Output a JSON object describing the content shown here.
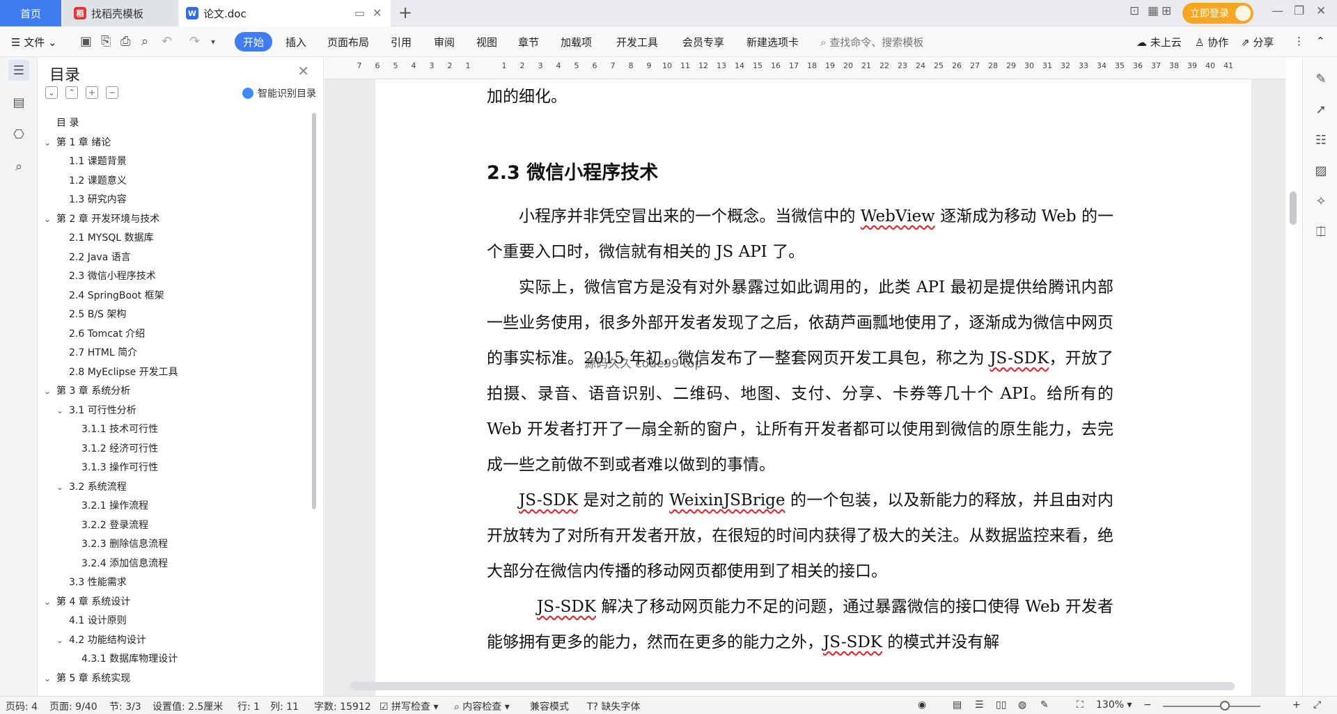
{
  "tabs": {
    "home": "首页",
    "templates": "找稻壳模板",
    "document": "论文.doc"
  },
  "header": {
    "login": "立即登录"
  },
  "ribbon": {
    "file": "文件",
    "menus": [
      "开始",
      "插入",
      "页面布局",
      "引用",
      "审阅",
      "视图",
      "章节",
      "加载项",
      "开发工具",
      "会员专享",
      "新建选项卡"
    ],
    "search_placeholder": "查找命令、搜索模板",
    "cloud": "未上云",
    "collab": "协作",
    "share": "分享"
  },
  "toc": {
    "title": "目录",
    "smart": "智能识别目录",
    "items": [
      {
        "label": "目  录",
        "level": 0,
        "expand": false
      },
      {
        "label": "第 1 章  绪论",
        "level": 0,
        "expand": true
      },
      {
        "label": "1.1  课题背景",
        "level": 1,
        "expand": false
      },
      {
        "label": "1.2  课题意义",
        "level": 1,
        "expand": false
      },
      {
        "label": "1.3  研究内容",
        "level": 1,
        "expand": false
      },
      {
        "label": "第 2 章  开发环境与技术",
        "level": 0,
        "expand": true
      },
      {
        "label": "2.1 MYSQL 数据库",
        "level": 1,
        "expand": false
      },
      {
        "label": "2.2 Java 语言",
        "level": 1,
        "expand": false
      },
      {
        "label": "2.3  微信小程序技术",
        "level": 1,
        "expand": false
      },
      {
        "label": "2.4 SpringBoot 框架",
        "level": 1,
        "expand": false
      },
      {
        "label": "2.5 B/S 架构",
        "level": 1,
        "expand": false
      },
      {
        "label": "2.6 Tomcat  介绍",
        "level": 1,
        "expand": false
      },
      {
        "label": "2.7 HTML 简介",
        "level": 1,
        "expand": false
      },
      {
        "label": "2.8 MyEclipse 开发工具",
        "level": 1,
        "expand": false
      },
      {
        "label": "第 3 章  系统分析",
        "level": 0,
        "expand": true
      },
      {
        "label": "3.1  可行性分析",
        "level": 1,
        "expand": true
      },
      {
        "label": "3.1.1  技术可行性",
        "level": 2,
        "expand": false
      },
      {
        "label": "3.1.2  经济可行性",
        "level": 2,
        "expand": false
      },
      {
        "label": "3.1.3  操作可行性",
        "level": 2,
        "expand": false
      },
      {
        "label": "3.2  系统流程",
        "level": 1,
        "expand": true
      },
      {
        "label": "3.2.1  操作流程",
        "level": 2,
        "expand": false
      },
      {
        "label": "3.2.2  登录流程",
        "level": 2,
        "expand": false
      },
      {
        "label": "3.2.3  删除信息流程",
        "level": 2,
        "expand": false
      },
      {
        "label": "3.2.4  添加信息流程",
        "level": 2,
        "expand": false
      },
      {
        "label": "3.3  性能需求",
        "level": 1,
        "expand": false
      },
      {
        "label": "第 4 章  系统设计",
        "level": 0,
        "expand": true
      },
      {
        "label": "4.1  设计原则",
        "level": 1,
        "expand": false
      },
      {
        "label": "4.2  功能结构设计",
        "level": 1,
        "expand": true
      },
      {
        "label": "4.3.1  数据库物理设计",
        "level": 2,
        "expand": false
      },
      {
        "label": "第 5 章  系统实现",
        "level": 0,
        "expand": true
      }
    ]
  },
  "ruler": [
    "7",
    "6",
    "5",
    "4",
    "3",
    "2",
    "1",
    "",
    "1",
    "2",
    "3",
    "4",
    "5",
    "6",
    "7",
    "8",
    "9",
    "10",
    "11",
    "12",
    "13",
    "14",
    "15",
    "16",
    "17",
    "18",
    "19",
    "20",
    "21",
    "22",
    "23",
    "24",
    "25",
    "26",
    "27",
    "28",
    "29",
    "30",
    "31",
    "32",
    "33",
    "34",
    "35",
    "36",
    "37",
    "38",
    "39",
    "40",
    "41"
  ],
  "document": {
    "line_prev": "加的细化。",
    "heading": "2.3  微信小程序技术",
    "p1_a": "小程序并非凭空冒出来的一个概念。当微信中的 ",
    "p1_b": "WebView",
    "p1_c": " 逐渐成为移动 Web 的一个重要入口时，微信就有相关的 JS API 了。",
    "p2_a": "实际上，微信官方是没有对外暴露过如此调用的，此类 API 最初是提供给腾讯内部一些业务使用，很多外部开发者发现了之后，依葫芦画瓢地使用了，逐渐成为微信中网页的事实标准。2015 年初，微信发布了一整套网页开发工具包，称之为 ",
    "p2_b": "JS-SDK",
    "p2_c": "，开放了拍摄、录音、语音识别、二维码、地图、支付、分享、卡券等几十个 API。给所有的 Web 开发者打开了一扇全新的窗户，让所有开发者都可以使用到微信的原生能力，去完成一些之前做不到或者难以做到的事情。",
    "p3_a": "JS-SDK",
    "p3_b": " 是对之前的 ",
    "p3_c": "WeixinJSBrige",
    "p3_d": " 的一个包装，以及新能力的释放，并且由对内开放转为了对所有开发者开放，在很短的时间内获得了极大的关注。从数据监控来看，绝大部分在微信内传播的移动网页都使用到了相关的接口。",
    "p4_a": "JS-SDK",
    "p4_b": " 解决了移动网页能力不足的问题，通过暴露微信的接口使得 Web 开发者能够拥有更多的能力，然而在更多的能力之外，",
    "p4_c": "JS-SDK",
    "p4_d": " 的模式并没有解",
    "watermark": "源码久久 code99 top"
  },
  "status": {
    "page_code": "页码: 4",
    "page": "页面: 9/40",
    "section": "节: 3/3",
    "setting": "设置值: 2.5厘米",
    "row": "行: 1",
    "col": "列: 11",
    "words": "字数: 15912",
    "spell": "拼写检查",
    "content_check": "内容检查",
    "compat": "兼容模式",
    "missing_font": "缺失字体",
    "zoom": "130%"
  }
}
